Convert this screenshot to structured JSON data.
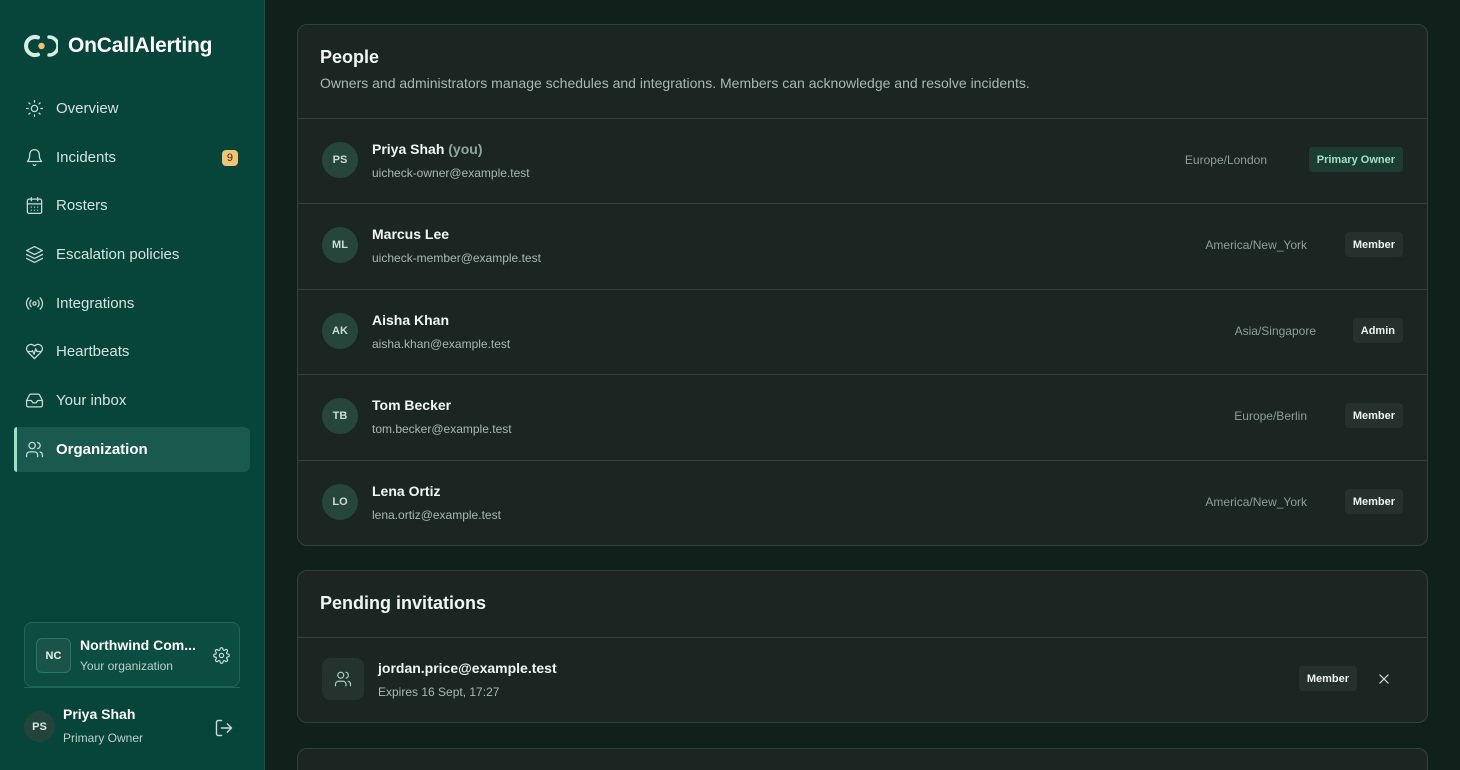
{
  "app": {
    "name": "OnCallAlerting"
  },
  "colors": {
    "sidebar_bg": "#07443a",
    "accent": "#9fe1c5",
    "badge": "#f0c477",
    "card_bg": "#1b2622"
  },
  "sidebar": {
    "items": [
      {
        "label": "Overview",
        "icon": "sun-icon"
      },
      {
        "label": "Incidents",
        "icon": "bell-icon",
        "badge": "9"
      },
      {
        "label": "Rosters",
        "icon": "calendar-icon"
      },
      {
        "label": "Escalation policies",
        "icon": "layers-icon"
      },
      {
        "label": "Integrations",
        "icon": "broadcast-icon"
      },
      {
        "label": "Heartbeats",
        "icon": "heart-pulse-icon"
      },
      {
        "label": "Your inbox",
        "icon": "inbox-icon"
      },
      {
        "label": "Organization",
        "icon": "users-icon",
        "active": true
      }
    ],
    "organization": {
      "initials": "NC",
      "name": "Northwind Com...",
      "subtitle": "Your organization"
    },
    "user": {
      "initials": "PS",
      "name": "Priya Shah",
      "role": "Primary Owner"
    }
  },
  "people": {
    "title": "People",
    "description": "Owners and administrators manage schedules and integrations. Members can acknowledge and resolve incidents.",
    "members": [
      {
        "initials": "PS",
        "name": "Priya Shah",
        "you": "(you)",
        "email": "uicheck-owner@example.test",
        "timezone": "Europe/London",
        "role": "Primary Owner"
      },
      {
        "initials": "ML",
        "name": "Marcus Lee",
        "you": "",
        "email": "uicheck-member@example.test",
        "timezone": "America/New_York",
        "role": "Member"
      },
      {
        "initials": "AK",
        "name": "Aisha Khan",
        "you": "",
        "email": "aisha.khan@example.test",
        "timezone": "Asia/Singapore",
        "role": "Admin"
      },
      {
        "initials": "TB",
        "name": "Tom Becker",
        "you": "",
        "email": "tom.becker@example.test",
        "timezone": "Europe/Berlin",
        "role": "Member"
      },
      {
        "initials": "LO",
        "name": "Lena Ortiz",
        "you": "",
        "email": "lena.ortiz@example.test",
        "timezone": "America/New_York",
        "role": "Member"
      }
    ]
  },
  "invitations": {
    "title": "Pending invitations",
    "items": [
      {
        "email": "jordan.price@example.test",
        "expires": "Expires 16 Sept, 17:27",
        "role": "Member"
      }
    ]
  }
}
